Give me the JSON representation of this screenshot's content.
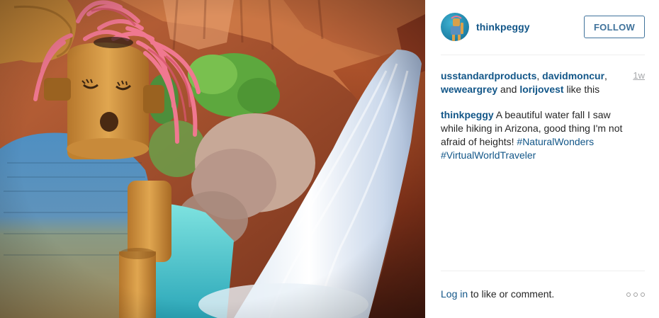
{
  "photo": {
    "alt": "",
    "scene": "puppet-at-waterfall"
  },
  "post": {
    "username": "thinkpeggy",
    "follow_label": "FOLLOW",
    "liked_by": [
      "usstandardproducts",
      "davidmoncur",
      "weweargrey",
      "lorijovest"
    ],
    "likes_sep_1": ", ",
    "likes_sep_2": ", ",
    "likes_and": " and ",
    "likes_suffix": " like this",
    "time_ago": "1w",
    "caption_user": "thinkpeggy",
    "caption_text": " A beautiful water fall I saw while hiking in Arizona, good thing I'm not afraid of heights! ",
    "hashtags": [
      "#NaturalWonders",
      "#VirtualWorldTraveler"
    ]
  },
  "footer": {
    "login_link": "Log in",
    "login_text": " to like or comment."
  },
  "colors": {
    "link": "#125688",
    "button_border": "#3f729b",
    "muted": "#a5a7aa"
  },
  "icons": {
    "more": "more-options-icon"
  }
}
